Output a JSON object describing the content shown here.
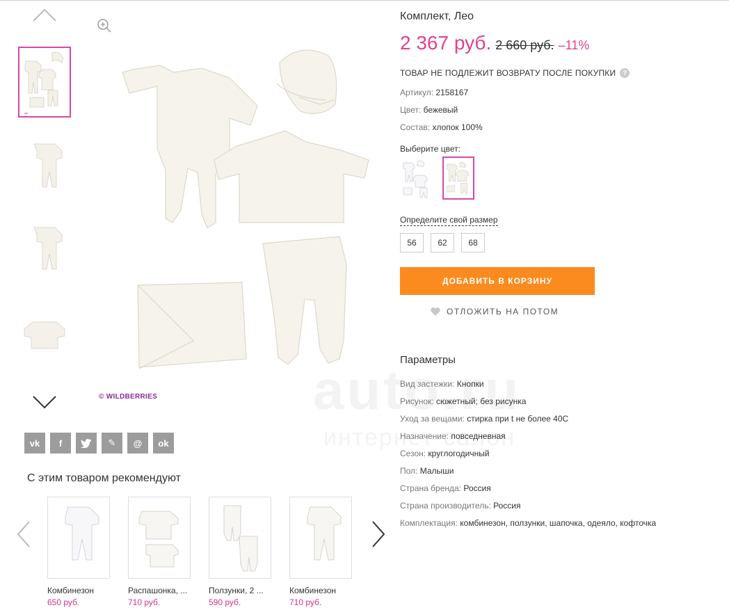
{
  "gallery": {
    "brand_mark": "© WILDBERRIES"
  },
  "social": [
    "vk",
    "f",
    "tw",
    "✎",
    "@",
    "ok"
  ],
  "recommend": {
    "title": "С этим товаром рекомендуют",
    "items": [
      {
        "name": "Комбинезон",
        "price": "650 руб."
      },
      {
        "name": "Распашонка, ...",
        "price": "710 руб."
      },
      {
        "name": "Ползунки, 2 ...",
        "price": "590 руб."
      },
      {
        "name": "Комбинезон",
        "price": "710 руб."
      }
    ]
  },
  "product": {
    "title": "Комплект, Лео",
    "price": "2 367 руб.",
    "old_price": "2 660 руб.",
    "discount": "–11%",
    "no_return": "ТОВАР НЕ ПОДЛЕЖИТ ВОЗВРАТУ ПОСЛЕ ПОКУПКИ",
    "help": "?",
    "article_label": "Артикул:",
    "article_value": "2158167",
    "color_label": "Цвет:",
    "color_value": "бежевый",
    "composition_label": "Состав:",
    "composition_value": "хлопок 100%",
    "choose_color": "Выберите цвет:",
    "size_link": "Определите свой размер",
    "sizes": [
      "56",
      "62",
      "68"
    ],
    "add_to_cart": "ДОБАВИТЬ В КОРЗИНУ",
    "later": "ОТЛОЖИТЬ НА ПОТОМ"
  },
  "params": {
    "title": "Параметры",
    "rows": [
      {
        "k": "Вид застежки:",
        "v": "Кнопки"
      },
      {
        "k": "Рисунок:",
        "v": "сюжетный; без рисунка"
      },
      {
        "k": "Уход за вещами:",
        "v": "стирка при t не более 40С"
      },
      {
        "k": "Назначение:",
        "v": "повседневная"
      },
      {
        "k": "Сезон:",
        "v": "круглогодичный"
      },
      {
        "k": "Пол:",
        "v": "Малыши"
      },
      {
        "k": "Страна бренда:",
        "v": "Россия"
      },
      {
        "k": "Страна производитель:",
        "v": "Россия"
      },
      {
        "k": "Комплектация:",
        "v": "комбинезон, ползунки, шапочка, одеяло, кофточка"
      }
    ]
  },
  "watermark": {
    "line1": "auto.ru",
    "line2": "интернет-салон"
  },
  "colors": {
    "accent": "#e0428f",
    "button": "#fb8b1e",
    "active_border": "#d946a8"
  }
}
